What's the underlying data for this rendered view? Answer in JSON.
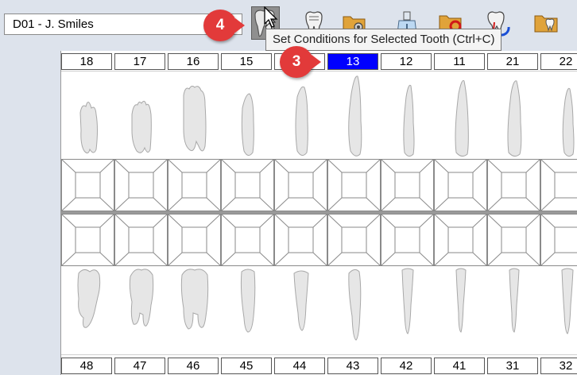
{
  "toolbar": {
    "provider_value": "D01 - J. Smiles",
    "buttons": [
      {
        "name": "set-conditions-button",
        "active": true
      },
      {
        "name": "tooth-chart-button",
        "active": false
      },
      {
        "name": "folder-settings-button",
        "active": false
      },
      {
        "name": "hygiene-button",
        "active": false
      },
      {
        "name": "folder-search-button",
        "active": false
      },
      {
        "name": "tooth-rotate-button",
        "active": false
      },
      {
        "name": "folder-tooth-button",
        "active": false
      }
    ]
  },
  "tooltip": {
    "text": "Set Conditions for Selected Tooth (Ctrl+C)"
  },
  "callouts": [
    {
      "label": "4"
    },
    {
      "label": "3"
    }
  ],
  "chart": {
    "upper_numbers": [
      "18",
      "17",
      "16",
      "15",
      "14",
      "13",
      "12",
      "11",
      "21",
      "22"
    ],
    "lower_numbers": [
      "48",
      "47",
      "46",
      "45",
      "44",
      "43",
      "42",
      "41",
      "31",
      "32"
    ],
    "selected_tooth": "13",
    "colors": {
      "selected": "#0000ff",
      "callout": "#e23a3a"
    }
  }
}
